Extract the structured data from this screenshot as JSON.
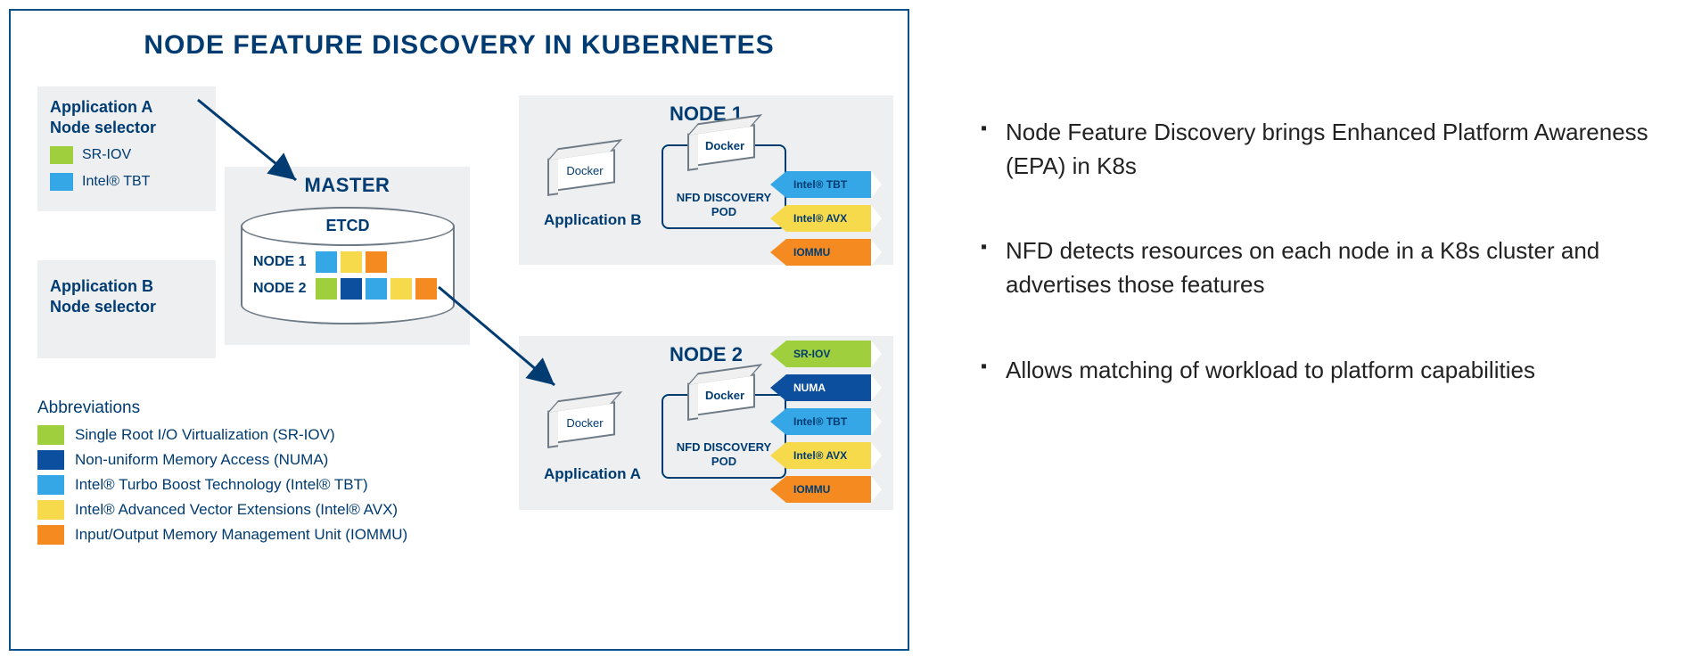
{
  "title": "NODE FEATURE DISCOVERY IN KUBERNETES",
  "appA": {
    "label": "Application A\nNode selector",
    "items": [
      "SR-IOV",
      "Intel® TBT"
    ]
  },
  "appB": {
    "label": "Application B\nNode selector"
  },
  "master": {
    "title": "MASTER",
    "etcd_label": "ETCD",
    "rows": [
      "NODE 1",
      "NODE 2"
    ]
  },
  "node1": {
    "title": "NODE 1",
    "docker": "Docker",
    "pod": "NFD DISCOVERY POD",
    "app": "Application B",
    "features": [
      {
        "label": "Intel® TBT",
        "cls": "c-lblue"
      },
      {
        "label": "Intel® AVX",
        "cls": "c-yellow"
      },
      {
        "label": "IOMMU",
        "cls": "c-orange"
      }
    ]
  },
  "node2": {
    "title": "NODE 2",
    "docker": "Docker",
    "pod": "NFD DISCOVERY POD",
    "app": "Application A",
    "features": [
      {
        "label": "SR-IOV",
        "cls": "c-green"
      },
      {
        "label": "NUMA",
        "cls": "c-dblue"
      },
      {
        "label": "Intel® TBT",
        "cls": "c-lblue"
      },
      {
        "label": "Intel® AVX",
        "cls": "c-yellow"
      },
      {
        "label": "IOMMU",
        "cls": "c-orange"
      }
    ]
  },
  "colors": {
    "green": "#9fcf3c",
    "dblue": "#0b4f9e",
    "lblue": "#35a7e6",
    "yellow": "#f7d94c",
    "orange": "#f58b20"
  },
  "abbreviations": {
    "title": "Abbreviations",
    "rows": [
      {
        "color": "green",
        "text": "Single Root I/O Virtualization (SR-IOV)"
      },
      {
        "color": "dblue",
        "text": "Non-uniform Memory Access (NUMA)"
      },
      {
        "color": "lblue",
        "text": "Intel® Turbo Boost Technology (Intel® TBT)"
      },
      {
        "color": "yellow",
        "text": "Intel® Advanced Vector Extensions (Intel® AVX)"
      },
      {
        "color": "orange",
        "text": "Input/Output Memory Management Unit (IOMMU)"
      }
    ]
  },
  "bullets": [
    "Node Feature Discovery brings Enhanced Platform Awareness (EPA) in K8s",
    "NFD detects resources on each node in a K8s cluster and advertises those features",
    "Allows matching of workload to platform capabilities"
  ],
  "etcd_node1_colors": [
    "lblue",
    "yellow",
    "orange"
  ],
  "etcd_node2_colors": [
    "green",
    "dblue",
    "lblue",
    "yellow",
    "orange"
  ]
}
